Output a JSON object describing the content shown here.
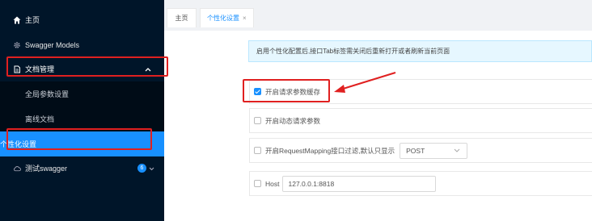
{
  "sidebar": {
    "home": {
      "label": "主页",
      "icon": "home-icon"
    },
    "swagger_models": {
      "label": "Swagger Models",
      "icon": "gear-icon"
    },
    "docs": {
      "label": "文档管理",
      "icon": "document-icon",
      "chevron": "up"
    },
    "sub_items": [
      {
        "label": "全局参数设置"
      },
      {
        "label": "离线文档"
      },
      {
        "label": "个性化设置"
      }
    ],
    "group": {
      "label": "测试swagger",
      "icon": "cloud-icon",
      "badge": "6"
    }
  },
  "tabs": [
    {
      "label": "主页"
    },
    {
      "label": "个性化设置",
      "close": "×"
    }
  ],
  "alert": {
    "text": "启用个性化配置后,接口Tab标签需关闭后重新打开或者刷新当前页面"
  },
  "settings": [
    {
      "label": "开启请求参数缓存",
      "checked": true
    },
    {
      "label": "开启动态请求参数",
      "checked": false
    },
    {
      "label": "开启RequestMapping接口过滤,默认只显示",
      "checked": false,
      "select_value": "POST"
    },
    {
      "label": "Host",
      "checked": false,
      "input_value": "127.0.0.1:8818"
    }
  ],
  "colors": {
    "accent": "#1890ff",
    "sidebar": "#001529",
    "annotation": "#e02020"
  }
}
